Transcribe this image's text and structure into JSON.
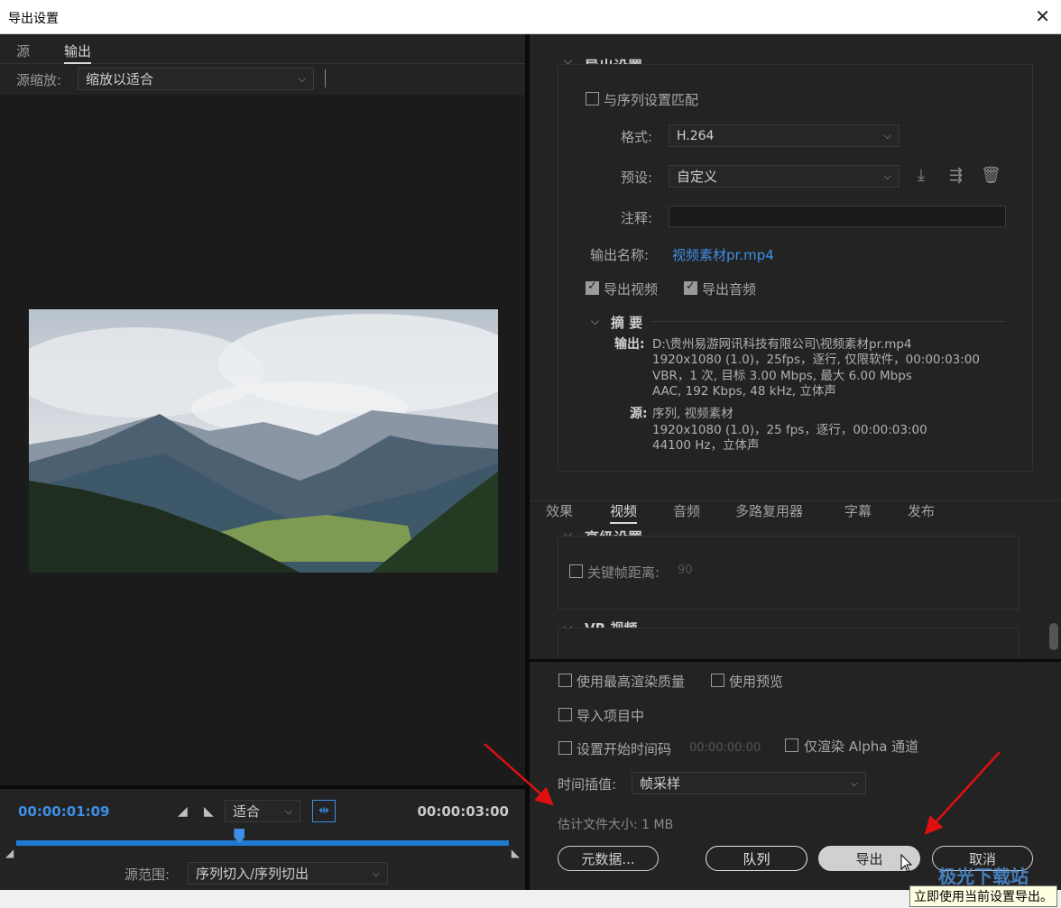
{
  "window": {
    "title": "导出设置",
    "close": "✕"
  },
  "left": {
    "tabs": [
      "源",
      "输出"
    ],
    "source_scale_label": "源缩放:",
    "source_scale_value": "缩放以适合",
    "timecode_current": "00:00:01:09",
    "timecode_end": "00:00:03:00",
    "fit_value": "适合",
    "source_range_label": "源范围:",
    "source_range_value": "序列切入/序列切出",
    "playhead_fraction": 0.453
  },
  "export_settings": {
    "header": "导出设置",
    "match_sequence": "与序列设置匹配",
    "format_label": "格式:",
    "format_value": "H.264",
    "preset_label": "预设:",
    "preset_value": "自定义",
    "comment_label": "注释:",
    "comment_value": "",
    "output_name_label": "输出名称:",
    "output_name_value": "视频素材pr.mp4",
    "export_video": "导出视频",
    "export_audio": "导出音频",
    "summary_header": "摘 要",
    "output_key": "输出:",
    "output_lines": [
      "D:\\贵州易游网讯科技有限公司\\视频素材pr.mp4",
      "1920x1080 (1.0)，25fps，逐行, 仅限软件，00:00:03:00",
      "VBR，1 次, 目标 3.00 Mbps, 最大 6.00 Mbps",
      "AAC, 192 Kbps, 48  kHz, 立体声"
    ],
    "source_key": "源:",
    "source_lines": [
      "序列, 视频素材",
      "1920x1080 (1.0)，25 fps，逐行，00:00:03:00",
      "44100 Hz，立体声"
    ]
  },
  "tabs": [
    "效果",
    "视频",
    "音频",
    "多路复用器",
    "字幕",
    "发布"
  ],
  "advanced": {
    "header": "高级设置",
    "keyframe_label": "关键帧距离:",
    "keyframe_value": "90",
    "vr_header": "VR 视频"
  },
  "bottom": {
    "max_render_quality": "使用最高渲染质量",
    "use_previews": "使用预览",
    "import_into_project": "导入项目中",
    "set_start_timecode": "设置开始时间码",
    "start_timecode_value": "00:00:00:00",
    "render_alpha_only": "仅渲染 Alpha 通道",
    "time_interpolation_label": "时间插值:",
    "time_interpolation_value": "帧采样",
    "estimated_size": "估计文件大小:  1 MB",
    "metadata_button": "元数据...",
    "queue_button": "队列",
    "export_button": "导出",
    "cancel_button": "取消",
    "tooltip": "立即使用当前设置导出。"
  },
  "watermark": "极光下载站"
}
